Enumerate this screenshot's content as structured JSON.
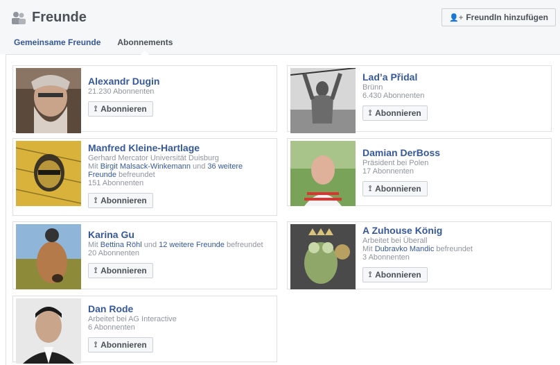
{
  "header": {
    "title": "Freunde",
    "add_friend_button": "FreundIn hinzufügen",
    "tabs": [
      {
        "label": "Gemeinsame Freunde"
      },
      {
        "label": "Abonnements"
      }
    ]
  },
  "cards": [
    {
      "name": "Alexandr Dugin",
      "lines": [
        "21.230 Abonnenten"
      ],
      "button": "Abonnieren"
    },
    {
      "name": "Lad’a Přidal",
      "lines": [
        "Brünn",
        "6.430 Abonnenten"
      ],
      "button": "Abonnieren"
    },
    {
      "name": "Manfred Kleine-Hartlage",
      "lines": [
        "Gerhard Mercator Universität Duisburg"
      ],
      "mutual": {
        "prefix": "Mit ",
        "link1": "Birgit Malsack-Winkemann",
        "mid": " und ",
        "link2": "36 weitere Freunde",
        "suffix": " befreundet"
      },
      "lines2": [
        "151 Abonnenten"
      ],
      "button": "Abonnieren"
    },
    {
      "name": "Damian DerBoss",
      "lines": [
        "Präsident bei Polen",
        "17 Abonnenten"
      ],
      "button": "Abonnieren"
    },
    {
      "name": "Karina Gu",
      "mutual": {
        "prefix": "Mit ",
        "link1": "Bettina Röhl",
        "mid": " und ",
        "link2": "12 weitere Freunde",
        "suffix": " befreundet"
      },
      "lines2": [
        "20 Abonnenten"
      ],
      "button": "Abonnieren"
    },
    {
      "name": "A Zuhouse König",
      "lines": [
        "Arbeitet bei Überall"
      ],
      "mutual": {
        "prefix": "Mit ",
        "link1": "Dubravko Mandic",
        "suffix": " befreundet"
      },
      "lines2": [
        "3 Abonnenten"
      ],
      "button": "Abonnieren"
    },
    {
      "name": "Dan Rode",
      "lines": [
        "Arbeitet bei AG Interactive",
        "6 Abonnenten"
      ],
      "button": "Abonnieren"
    }
  ],
  "icons": {
    "friends": "friends-icon",
    "add_friend": "add-friend-icon",
    "subscribe": "rss-icon"
  },
  "colors": {
    "link": "#365899",
    "header_bg": "#f6f7f9"
  }
}
